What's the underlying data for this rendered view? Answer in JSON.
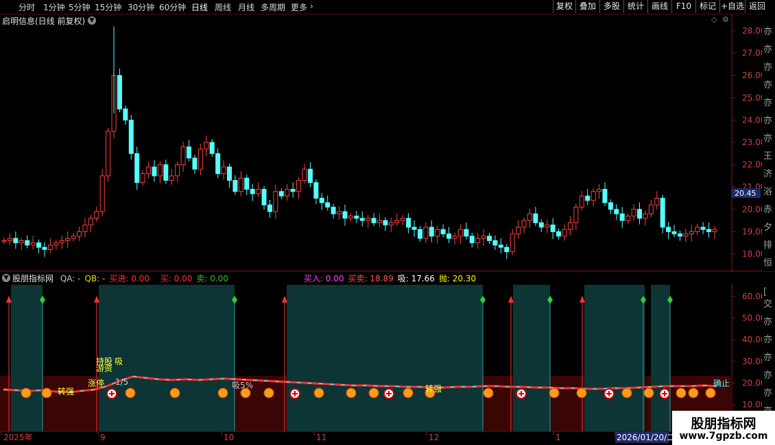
{
  "toolbar": {
    "periods": [
      "分时",
      "1分钟",
      "5分钟",
      "15分钟",
      "30分钟",
      "60分钟",
      "日线",
      "周线",
      "月线",
      "多周期",
      "更多"
    ],
    "active": "日线",
    "right_buttons": [
      "复权",
      "叠加",
      "多股",
      "统计",
      "画线",
      "F10",
      "标记",
      "+自选",
      "返回"
    ]
  },
  "main_chart": {
    "title": "启明信息(日线 前复权)",
    "price_axis": [
      "28.00",
      "27.00",
      "26.00",
      "25.00",
      "24.00",
      "23.00",
      "22.00",
      "21.00",
      "20.00",
      "19.00",
      "18.00"
    ],
    "current_price": "20.45"
  },
  "indicator": {
    "title": "股朋指标网",
    "fields": [
      {
        "label": "QA:",
        "value": "-",
        "color": "#c8c8c8"
      },
      {
        "label": "QB:",
        "value": "-",
        "color": "#e0e000"
      },
      {
        "label": "买进:",
        "value": "0.00",
        "color": "#ff3030"
      },
      {
        "label": "",
        "value": "",
        "color": "#555"
      },
      {
        "label": "买:",
        "value": "0.00",
        "color": "#ff3030"
      },
      {
        "label": "卖:",
        "value": "0.00",
        "color": "#30c030"
      },
      {
        "label": "买入:",
        "value": "0.00",
        "color": "#ff40ff"
      },
      {
        "label": "买卖:",
        "value": "18.89",
        "color": "#ff5050"
      },
      {
        "label": "吸:",
        "value": "17.66",
        "color": "#ffffff"
      },
      {
        "label": "抛:",
        "value": "20.30",
        "color": "#ffff00"
      }
    ],
    "axis": [
      "60.00",
      "50.00",
      "40.00",
      "30.00",
      "20.00",
      "10.00"
    ],
    "labels": [
      "转强",
      "游资",
      "涨停",
      "持股",
      "吸",
      "1/5",
      "吸5%",
      "转强",
      "确止"
    ]
  },
  "time_axis": [
    "2025年",
    "9",
    "10",
    "11",
    "12",
    "1",
    "2026/01/20/二"
  ],
  "watermark": {
    "name": "股朋指标网",
    "url": "www.7gpzb.com"
  }
}
